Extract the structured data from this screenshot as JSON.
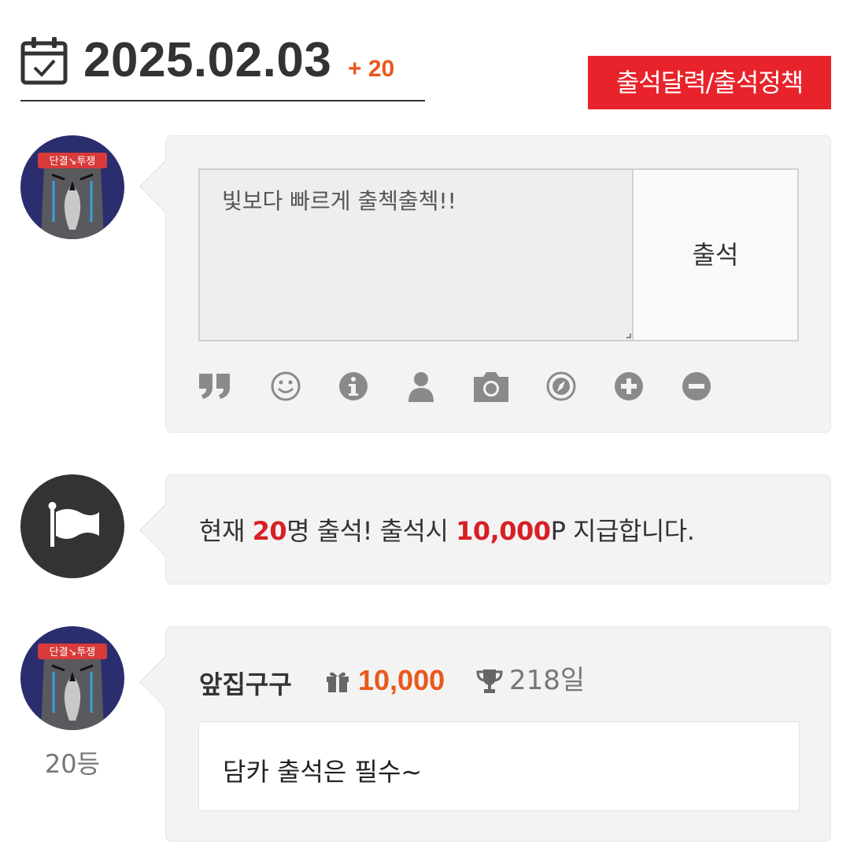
{
  "header": {
    "date": "2025.02.03",
    "bonus": "+ 20",
    "policy_button": "출석달력/출석정책",
    "calendar_icon": "calendar-check-icon"
  },
  "write_form": {
    "memo_value": "빛보다 빠르게 출첵출첵!!",
    "submit_label": "출석",
    "avatar_text": "단결↘투쟁",
    "tools": [
      "quote-icon",
      "smile-icon",
      "info-icon",
      "user-icon",
      "camera-icon",
      "compass-icon",
      "plus-circle-icon",
      "minus-circle-icon"
    ]
  },
  "notice": {
    "prefix": "현재 ",
    "count": "20",
    "middle": "명 출석! 출석시 ",
    "points": "10,000",
    "suffix": "P 지급합니다.",
    "icon": "flag-icon",
    "highlight_color": "#d81f26"
  },
  "entry": {
    "name": "앞집구구",
    "points": "10,000",
    "days": "218일",
    "message": "담카 출석은 필수~",
    "rank": "20등",
    "avatar_text": "단결↘투쟁",
    "points_color": "#e8581c"
  },
  "colors": {
    "accent": "#e8232b",
    "bonus": "#e8581c",
    "bubble_bg": "#f3f3f3"
  }
}
